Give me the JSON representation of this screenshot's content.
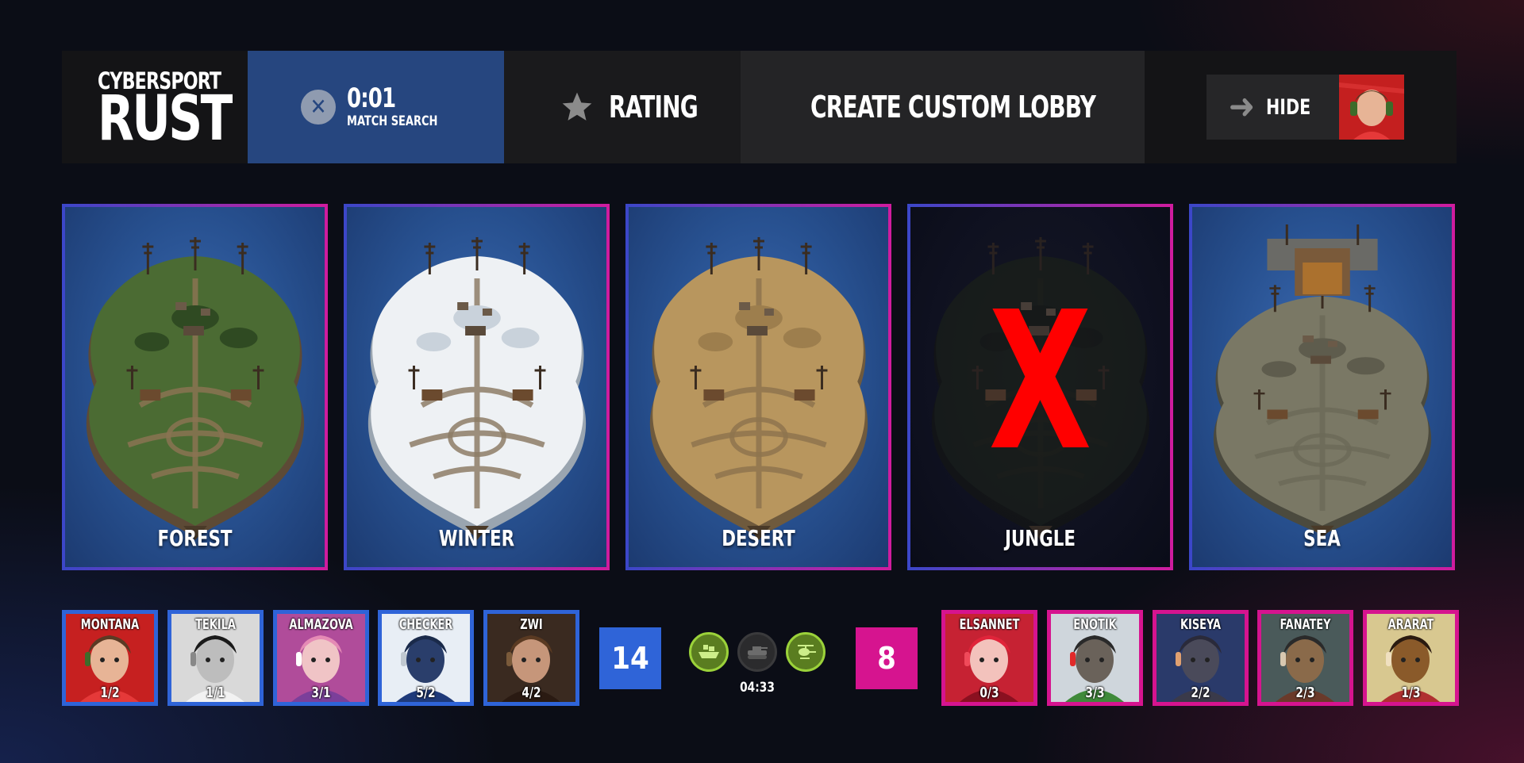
{
  "logo": {
    "line1": "CYBERSPORT",
    "line2": "RUST"
  },
  "search": {
    "timer": "0:01",
    "label": "MATCH SEARCH"
  },
  "nav": {
    "rating": "RATING",
    "create_lobby": "CREATE CUSTOM LOBBY",
    "hide": "HIDE"
  },
  "maps": [
    {
      "name": "FOREST",
      "theme": "forest",
      "banned": false
    },
    {
      "name": "WINTER",
      "theme": "winter",
      "banned": false
    },
    {
      "name": "DESERT",
      "theme": "desert",
      "banned": false
    },
    {
      "name": "JUNGLE",
      "theme": "jungle",
      "banned": true,
      "ban_mark": "X"
    },
    {
      "name": "SEA",
      "theme": "sea",
      "banned": false
    }
  ],
  "team_blue": {
    "score": "14",
    "color": "#2f64d8",
    "players": [
      {
        "name": "MONTANA",
        "score": "1/2"
      },
      {
        "name": "TEKILA",
        "score": "1/1"
      },
      {
        "name": "ALMAZOVA",
        "score": "3/1"
      },
      {
        "name": "CHECKER",
        "score": "5/2"
      },
      {
        "name": "ZWI",
        "score": "4/2"
      }
    ]
  },
  "team_pink": {
    "score": "8",
    "color": "#d6148f",
    "players": [
      {
        "name": "ELSANNET",
        "score": "0/3"
      },
      {
        "name": "ENOTIK",
        "score": "3/3"
      },
      {
        "name": "KISEYA",
        "score": "2/2"
      },
      {
        "name": "FANATEY",
        "score": "2/3"
      },
      {
        "name": "ARARAT",
        "score": "1/3"
      }
    ]
  },
  "events": {
    "timer": "04:33",
    "items": [
      {
        "icon": "cargo-ship-icon",
        "active": true
      },
      {
        "icon": "tank-icon",
        "active": false
      },
      {
        "icon": "helicopter-icon",
        "active": true
      }
    ]
  },
  "colors": {
    "accent_blue": "#2f64d8",
    "accent_pink": "#d6148f",
    "search_bg": "#26467f",
    "ban": "#ff0000",
    "event_active": "#9bd23a"
  }
}
